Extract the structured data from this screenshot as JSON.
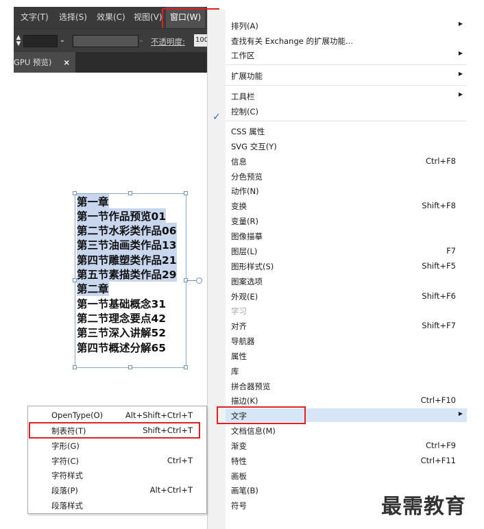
{
  "menubar": {
    "items": [
      "文字(T)",
      "选择(S)",
      "效果(C)",
      "视图(V)",
      "窗口(W)"
    ]
  },
  "control_bar": {
    "opacity_label": "不透明度:",
    "opacity_value": "100"
  },
  "document_tab": {
    "label": "GPU 预览)",
    "close": "×"
  },
  "artboard": {
    "lines": [
      "第一章",
      "第一节作品预览01",
      "第二节水彩类作品06",
      "第三节油画类作品13",
      "第四节雕塑类作品21",
      "第五节素描类作品29",
      "第二章",
      "第一节基础概念31",
      "第二节理念要点42",
      "第三节深入讲解52",
      "第四节概述分解65"
    ]
  },
  "window_menu": {
    "items": [
      {
        "label": "排列(A)",
        "shortcut": "",
        "submenu": true
      },
      {
        "label": "查找有关 Exchange 的扩展功能...",
        "shortcut": "",
        "submenu": false
      },
      {
        "label": "工作区",
        "shortcut": "",
        "submenu": true
      },
      {
        "label": "扩展功能",
        "shortcut": "",
        "submenu": true
      },
      {
        "label": "工具栏",
        "shortcut": "",
        "submenu": true
      },
      {
        "label": "控制(C)",
        "shortcut": "",
        "submenu": false,
        "checked": true
      },
      {
        "label": "CSS 属性",
        "shortcut": ""
      },
      {
        "label": "SVG 交互(Y)",
        "shortcut": ""
      },
      {
        "label": "信息",
        "shortcut": "Ctrl+F8"
      },
      {
        "label": "分色预览",
        "shortcut": ""
      },
      {
        "label": "动作(N)",
        "shortcut": ""
      },
      {
        "label": "变换",
        "shortcut": "Shift+F8"
      },
      {
        "label": "变量(R)",
        "shortcut": ""
      },
      {
        "label": "图像描摹",
        "shortcut": ""
      },
      {
        "label": "图层(L)",
        "shortcut": "F7"
      },
      {
        "label": "图形样式(S)",
        "shortcut": "Shift+F5"
      },
      {
        "label": "图案选项",
        "shortcut": ""
      },
      {
        "label": "外观(E)",
        "shortcut": "Shift+F6"
      },
      {
        "label": "学习",
        "shortcut": "",
        "disabled": true
      },
      {
        "label": "对齐",
        "shortcut": "Shift+F7"
      },
      {
        "label": "导航器",
        "shortcut": ""
      },
      {
        "label": "属性",
        "shortcut": ""
      },
      {
        "label": "库",
        "shortcut": ""
      },
      {
        "label": "拼合器预览",
        "shortcut": ""
      },
      {
        "label": "描边(K)",
        "shortcut": "Ctrl+F10"
      },
      {
        "label": "文字",
        "shortcut": "",
        "submenu": true,
        "highlighted": true
      },
      {
        "label": "文档信息(M)",
        "shortcut": ""
      },
      {
        "label": "渐变",
        "shortcut": "Ctrl+F9"
      },
      {
        "label": "特性",
        "shortcut": "Ctrl+F11"
      },
      {
        "label": "画板",
        "shortcut": ""
      },
      {
        "label": "画笔(B)",
        "shortcut": ""
      },
      {
        "label": "符号",
        "shortcut": ""
      }
    ],
    "check_mark": "✓",
    "submenu_arrow": "▶"
  },
  "type_submenu": {
    "items": [
      {
        "label": "OpenType(O)",
        "shortcut": "Alt+Shift+Ctrl+T"
      },
      {
        "label": "制表符(T)",
        "shortcut": "Shift+Ctrl+T"
      },
      {
        "label": "字形(G)",
        "shortcut": ""
      },
      {
        "label": "字符(C)",
        "shortcut": "Ctrl+T"
      },
      {
        "label": "字符样式",
        "shortcut": ""
      },
      {
        "label": "段落(P)",
        "shortcut": "Alt+Ctrl+T"
      },
      {
        "label": "段落样式",
        "shortcut": ""
      }
    ]
  },
  "watermark": "最需教育",
  "colors": {
    "chrome_dark": "#3a3a3a",
    "highlight_box": "#e02020",
    "menu_hover": "#d7e6f7",
    "check": "#2a66c7"
  }
}
